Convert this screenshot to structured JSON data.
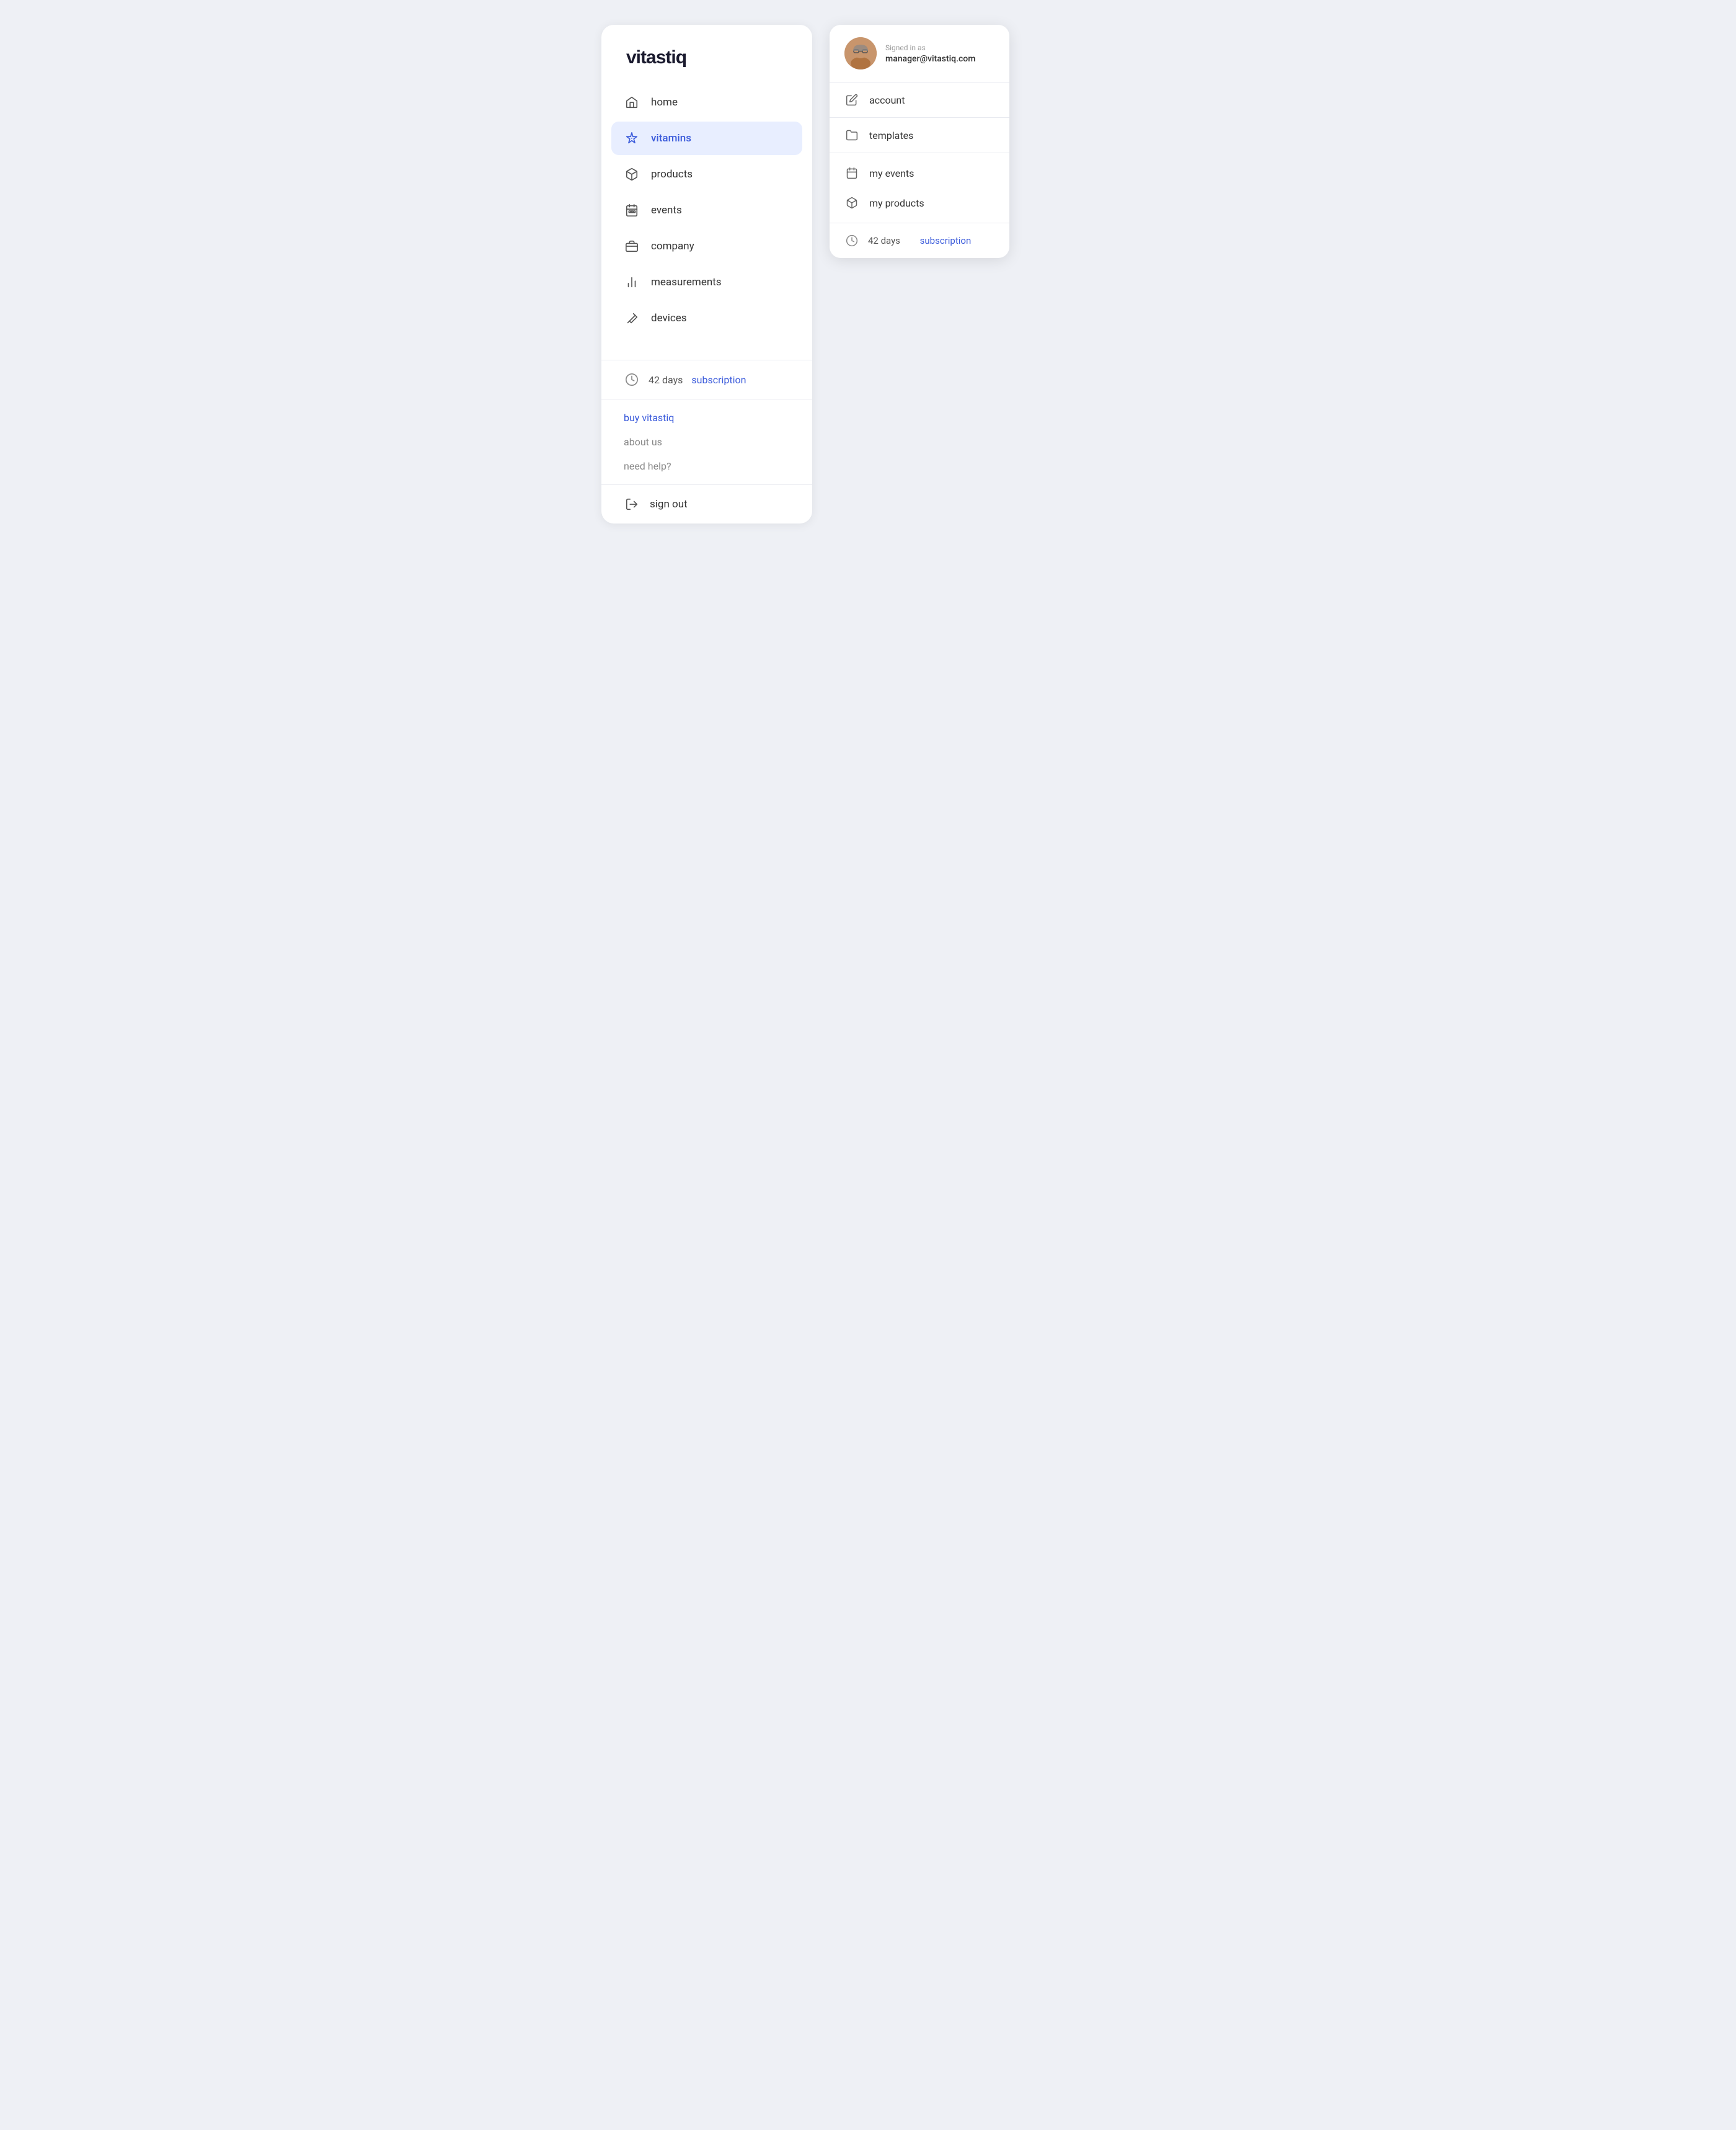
{
  "app": {
    "title": "vitastiq"
  },
  "sidebar": {
    "logo": "vitastiq",
    "nav_items": [
      {
        "id": "home",
        "label": "home",
        "icon": "home-icon",
        "active": false
      },
      {
        "id": "vitamins",
        "label": "vitamins",
        "icon": "sparkle-icon",
        "active": true
      },
      {
        "id": "products",
        "label": "products",
        "icon": "box-icon",
        "active": false
      },
      {
        "id": "events",
        "label": "events",
        "icon": "calendar-icon",
        "active": false
      },
      {
        "id": "company",
        "label": "company",
        "icon": "briefcase-icon",
        "active": false
      },
      {
        "id": "measurements",
        "label": "measurements",
        "icon": "chart-icon",
        "active": false
      },
      {
        "id": "devices",
        "label": "devices",
        "icon": "pencil-icon",
        "active": false
      }
    ],
    "subscription": {
      "days": "42 days",
      "link_label": "subscription"
    },
    "footer_links": [
      {
        "id": "buy",
        "label": "buy vitastiq",
        "style": "blue"
      },
      {
        "id": "about",
        "label": "about us",
        "style": "gray"
      },
      {
        "id": "help",
        "label": "need help?",
        "style": "gray"
      }
    ],
    "sign_out": {
      "label": "sign out",
      "icon": "signout-icon"
    }
  },
  "dropdown": {
    "user": {
      "signed_in_label": "Signed in as",
      "email": "manager@vitastiq.com"
    },
    "items": [
      {
        "id": "account",
        "label": "account",
        "icon": "edit-icon"
      },
      {
        "id": "templates",
        "label": "templates",
        "icon": "folder-icon"
      }
    ],
    "my_section": [
      {
        "id": "my-events",
        "label": "my events",
        "icon": "calendar-small-icon"
      },
      {
        "id": "my-products",
        "label": "my products",
        "icon": "box-small-icon"
      }
    ],
    "subscription": {
      "days": "42 days",
      "link_label": "subscription"
    }
  }
}
